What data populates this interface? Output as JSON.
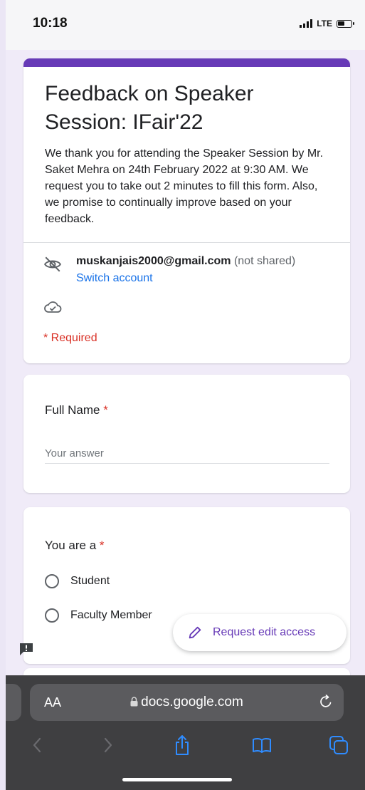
{
  "status_bar": {
    "time": "10:18",
    "network": "LTE"
  },
  "form": {
    "title": "Feedback on Speaker Session: IFair'22",
    "description": "We thank you for attending the Speaker Session by Mr. Saket Mehra on 24th February 2022 at 9:30 AM. We request you to take out 2 minutes to fill this form. Also, we promise to continually improve based on your feedback.",
    "account_email": "muskanjais2000@gmail.com",
    "account_note": "(not shared)",
    "switch_account_label": "Switch account",
    "required_note": "* Required",
    "accent_color": "#673ab7"
  },
  "questions": {
    "full_name": {
      "label": "Full Name",
      "required_mark": "*",
      "placeholder": "Your answer"
    },
    "role": {
      "label": "You are a",
      "required_mark": "*",
      "options": [
        "Student",
        "Faculty Member"
      ]
    }
  },
  "fab": {
    "label": "Request edit access",
    "icon": "pencil-icon"
  },
  "browser": {
    "text_size_label": "AA",
    "url": "docs.google.com",
    "icons": [
      "back-icon",
      "forward-icon",
      "share-icon",
      "bookmarks-icon",
      "tabs-icon",
      "reload-icon",
      "lock-icon"
    ]
  }
}
